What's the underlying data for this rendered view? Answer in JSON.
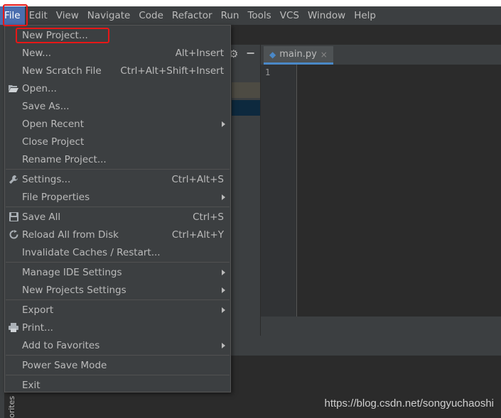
{
  "menubar": {
    "items": [
      "File",
      "Edit",
      "View",
      "Navigate",
      "Code",
      "Refactor",
      "Run",
      "Tools",
      "VCS",
      "Window",
      "Help"
    ]
  },
  "editor": {
    "tab_label": "main.py",
    "tab_close": "×",
    "line_number": "1"
  },
  "sidebar": {
    "vertical_label": "orites"
  },
  "file_menu": {
    "new_project": "New Project...",
    "new": "New...",
    "new_shortcut": "Alt+Insert",
    "new_scratch": "New Scratch File",
    "new_scratch_shortcut": "Ctrl+Alt+Shift+Insert",
    "open": "Open...",
    "save_as": "Save As...",
    "open_recent": "Open Recent",
    "close_project": "Close Project",
    "rename_project": "Rename Project...",
    "settings": "Settings...",
    "settings_shortcut": "Ctrl+Alt+S",
    "file_properties": "File Properties",
    "save_all": "Save All",
    "save_all_shortcut": "Ctrl+S",
    "reload": "Reload All from Disk",
    "reload_shortcut": "Ctrl+Alt+Y",
    "invalidate": "Invalidate Caches / Restart...",
    "manage_ide": "Manage IDE Settings",
    "new_projects_settings": "New Projects Settings",
    "export": "Export",
    "print": "Print...",
    "add_favorites": "Add to Favorites",
    "power_save": "Power Save Mode",
    "exit": "Exit"
  },
  "watermark": "https://blog.csdn.net/songyuchaoshi",
  "colors": {
    "highlight_box": "#e81717",
    "menu_bg": "#3c3f41",
    "active_menu": "#4b6eaf",
    "editor_bg": "#2b2b2b"
  }
}
